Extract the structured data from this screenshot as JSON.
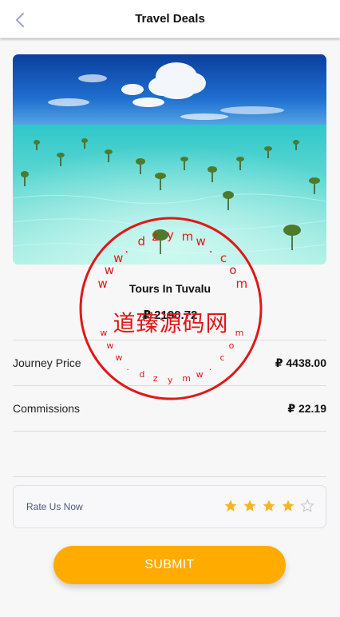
{
  "header": {
    "title": "Travel Deals",
    "back_icon": "chevron-left-icon"
  },
  "hero": {
    "image_desc_icon": "beach-photo"
  },
  "tour": {
    "title": "Tours In Tuvalu",
    "price": "₽ 2190.72"
  },
  "rows": [
    {
      "label": "Journey Price",
      "value": "₽ 4438.00"
    },
    {
      "label": "Commissions",
      "value": "₽ 22.19"
    }
  ],
  "rating": {
    "label": "Rate Us Now",
    "rating": 4,
    "max": 5,
    "star_color": "#f5b623",
    "empty_color": "#c9c9cf"
  },
  "submit": {
    "label": "SUBMIT",
    "color": "#ffab00"
  },
  "watermark": {
    "center_text": "道臻源码网",
    "ring_text": "www.dzymw.com",
    "color": "#e01818"
  }
}
